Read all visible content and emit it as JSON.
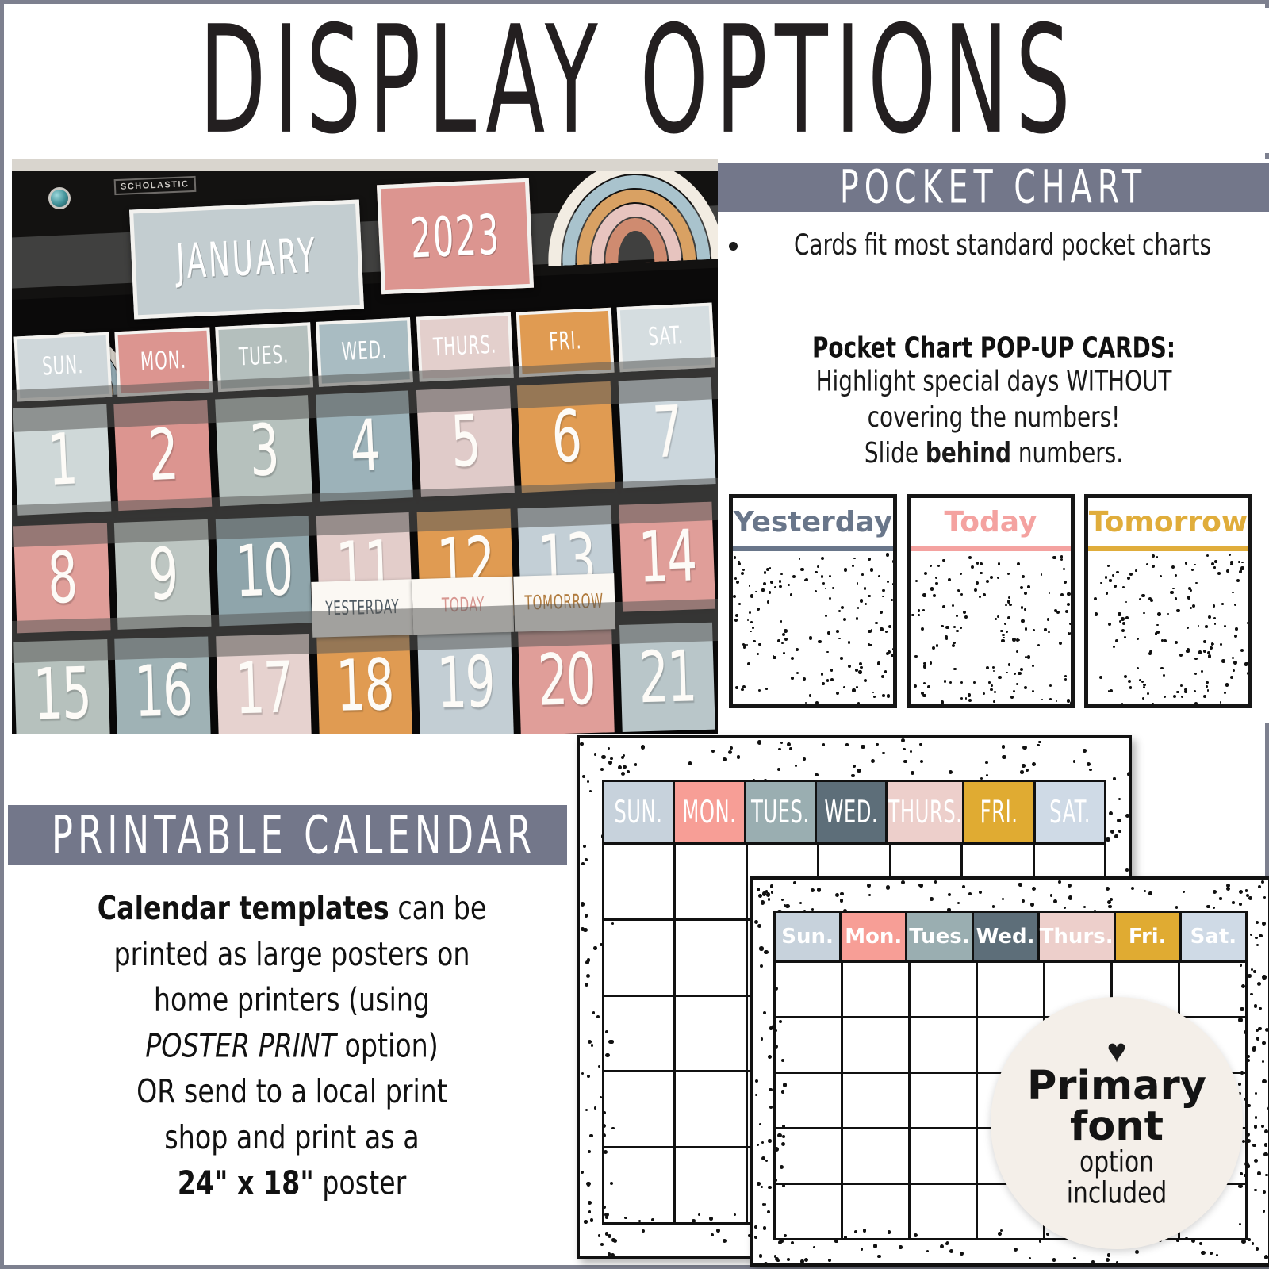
{
  "page": {
    "title": "DISPLAY OPTIONS",
    "border_color": "#7d808f",
    "header_bar_color": "#73778a"
  },
  "pocket_chart_section": {
    "heading": "POCKET CHART",
    "bullet": "Cards fit most standard pocket charts",
    "popup_title": "Pocket Chart POP-UP CARDS:",
    "popup_line1": "Highlight special days WITHOUT",
    "popup_line2": "covering the numbers!",
    "popup_line3_pre": "Slide ",
    "popup_line3_bold": "behind",
    "popup_line3_post": " numbers.",
    "popup_cards": [
      {
        "label": "Yesterday",
        "color": "#69768a"
      },
      {
        "label": "Today",
        "color": "#f4a2a0"
      },
      {
        "label": "Tomorrow",
        "color": "#e0ad3b"
      }
    ]
  },
  "photo": {
    "brand": "SCHOLASTIC",
    "month": "JANUARY",
    "year": "2023",
    "month_card_color": "#c3cdd0",
    "year_card_color": "#dc9590",
    "days": [
      {
        "label": "SUN.",
        "color": "#cfd7da"
      },
      {
        "label": "MON.",
        "color": "#dc9590"
      },
      {
        "label": "TUES.",
        "color": "#b4bfbd"
      },
      {
        "label": "WED.",
        "color": "#a9bcc2"
      },
      {
        "label": "THURS.",
        "color": "#e3cfcc"
      },
      {
        "label": "FRI.",
        "color": "#e09b52"
      },
      {
        "label": "SAT.",
        "color": "#d5dde0"
      }
    ],
    "numbers_row1": [
      {
        "n": "1",
        "color": "#cfd8d8"
      },
      {
        "n": "2",
        "color": "#dc9590"
      },
      {
        "n": "3",
        "color": "#b6c1bd"
      },
      {
        "n": "4",
        "color": "#9cb2b9"
      },
      {
        "n": "5",
        "color": "#e0cbc9"
      },
      {
        "n": "6",
        "color": "#e09b52"
      },
      {
        "n": "7",
        "color": "#ccd7dd"
      }
    ],
    "numbers_row2": [
      {
        "n": "8",
        "color": "#e09e99"
      },
      {
        "n": "9",
        "color": "#bdc6c2"
      },
      {
        "n": "10",
        "color": "#8fa5ab"
      },
      {
        "n": "11",
        "color": "#e3cdca"
      },
      {
        "n": "12",
        "color": "#e09b52"
      },
      {
        "n": "13",
        "color": "#c3cfd6"
      },
      {
        "n": "14",
        "color": "#e09e99"
      }
    ],
    "numbers_row3": [
      {
        "n": "15",
        "color": "#b6c1bd"
      },
      {
        "n": "16",
        "color": "#9fb2b5"
      },
      {
        "n": "17",
        "color": "#e6d2cf"
      },
      {
        "n": "18",
        "color": "#e09b52",
        "popup": "YESTERDAY",
        "popup_color": "#4f5a62"
      },
      {
        "n": "19",
        "color": "#c3ced4",
        "popup": "TODAY",
        "popup_color": "#d79791"
      },
      {
        "n": "20",
        "color": "#e09e99",
        "popup": "TOMORROW",
        "popup_color": "#b07a3c"
      },
      {
        "n": "21",
        "color": "#b9c6c9"
      }
    ]
  },
  "printable_section": {
    "heading": "PRINTABLE CALENDAR",
    "line1_bold": "Calendar templates",
    "line1_rest": " can be",
    "line2": "printed as large posters on",
    "line3": "home printers (using",
    "line4_italic": "POSTER PRINT",
    "line4_rest": " option)",
    "line5": "OR send to a local print",
    "line6": "shop and print as a",
    "line7_bold": "24\" x 18\"",
    "line7_rest": " poster"
  },
  "calendar_back": {
    "days": [
      {
        "label": "SUN.",
        "color": "#c7d2dc"
      },
      {
        "label": "MON.",
        "color": "#f79e96"
      },
      {
        "label": "TUES.",
        "color": "#9aaeb1"
      },
      {
        "label": "WED.",
        "color": "#5d6e79"
      },
      {
        "label": "THURS.",
        "color": "#edcfcb"
      },
      {
        "label": "FRI.",
        "color": "#e0ab32"
      },
      {
        "label": "SAT.",
        "color": "#cfdae6"
      }
    ],
    "rows": 5
  },
  "calendar_front": {
    "days": [
      {
        "label": "Sun.",
        "color": "#c7d2dc"
      },
      {
        "label": "Mon.",
        "color": "#f79e96"
      },
      {
        "label": "Tues.",
        "color": "#9aaeb1"
      },
      {
        "label": "Wed.",
        "color": "#5d6e79"
      },
      {
        "label": "Thurs.",
        "color": "#edcfcb"
      },
      {
        "label": "Fri.",
        "color": "#e0ab32"
      },
      {
        "label": "Sat.",
        "color": "#cfdae6"
      }
    ],
    "rows": 5
  },
  "badge": {
    "heart": "♥",
    "line1": "Primary",
    "line2": "font",
    "line3": "option",
    "line4": "included",
    "background": "#f4efe9"
  }
}
